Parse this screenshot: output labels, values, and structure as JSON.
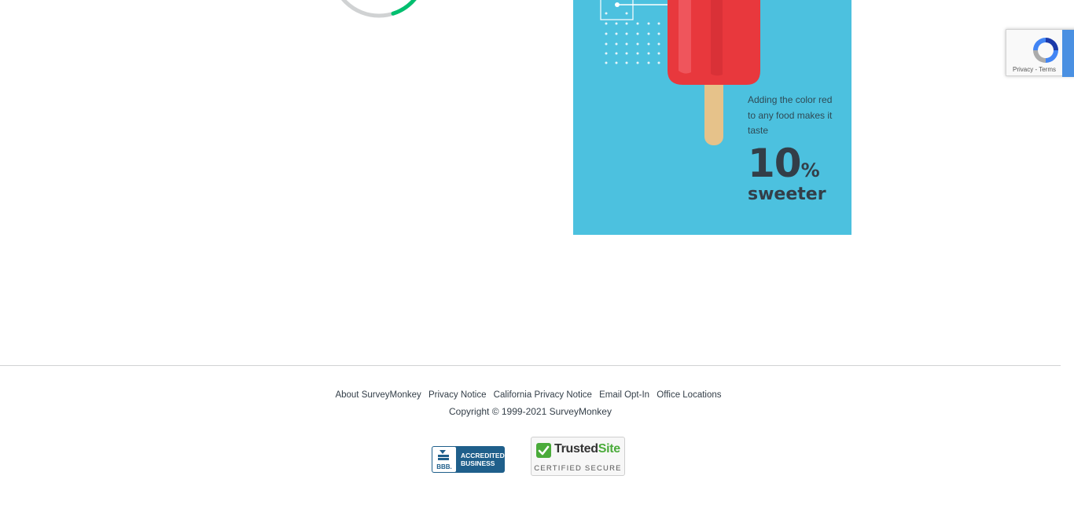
{
  "progress": {
    "fraction": 0.3
  },
  "ad": {
    "caption": "Adding the color red to any food makes it taste",
    "number": "10",
    "unit": "%",
    "word": "sweeter"
  },
  "recaptcha": {
    "privacy": "Privacy",
    "separator": " - ",
    "terms": "Terms"
  },
  "footer": {
    "links": [
      "About SurveyMonkey",
      "Privacy Notice",
      "California Privacy Notice",
      "Email Opt-In",
      "Office Locations"
    ],
    "copyright": "Copyright © 1999-2021 SurveyMonkey"
  },
  "badges": {
    "bbb": {
      "line1": "ACCREDITED",
      "line2": "BUSINESS",
      "mark": "BBB."
    },
    "trusted": {
      "brand_a": "Trusted",
      "brand_b": "Site",
      "sub": "CERTIFIED SECURE"
    }
  },
  "colors": {
    "ad_background": "#4cc1df",
    "progress_track": "#d0d2d3",
    "progress_fill": "#00bf6f",
    "bbb_blue": "#1f5f8b",
    "trusted_green": "#4aab3a"
  }
}
